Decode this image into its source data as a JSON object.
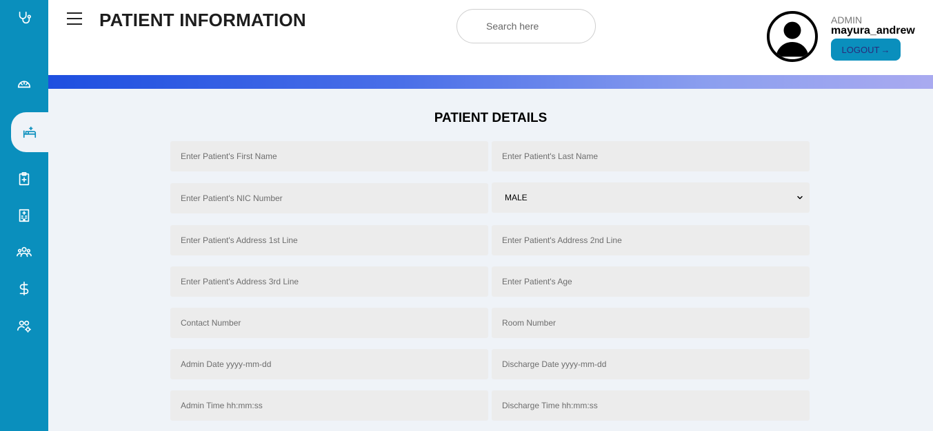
{
  "sidebar": {
    "items": [
      {
        "name": "stethoscope-icon"
      },
      {
        "name": "dashboard-icon"
      },
      {
        "name": "patient-bed-icon",
        "active": true
      },
      {
        "name": "clipboard-medical-icon"
      },
      {
        "name": "hospital-building-icon"
      },
      {
        "name": "staff-group-icon"
      },
      {
        "name": "dollar-icon"
      },
      {
        "name": "user-settings-icon"
      }
    ]
  },
  "header": {
    "title": "PATIENT INFORMATION",
    "search_placeholder": "Search here",
    "role": "ADMIN",
    "username": "mayura_andrew",
    "logout_label": "LOGOUT",
    "logout_icon": "→"
  },
  "form": {
    "title": "PATIENT DETAILS",
    "first_name_placeholder": "Enter Patient's First Name",
    "last_name_placeholder": "Enter Patient's Last Name",
    "nic_placeholder": "Enter Patient's NIC Number",
    "gender_value": "MALE",
    "address1_placeholder": "Enter Patient's Address 1st Line",
    "address2_placeholder": "Enter Patient's Address 2nd Line",
    "address3_placeholder": "Enter Patient's Address 3rd Line",
    "age_placeholder": "Enter Patient's Age",
    "contact_placeholder": "Contact Number",
    "room_placeholder": "Room Number",
    "admin_date_placeholder": "Admin Date yyyy-mm-dd",
    "discharge_date_placeholder": "Discharge Date yyyy-mm-dd",
    "admin_time_placeholder": "Admin Time hh:mm:ss",
    "discharge_time_placeholder": "Discharge Time hh:mm:ss"
  },
  "colors": {
    "sidebar": "#0a8fbd",
    "background": "#eff3f8",
    "field": "#ececec",
    "gradient_start": "#1e4fe0",
    "gradient_end": "#a9aaf0"
  }
}
